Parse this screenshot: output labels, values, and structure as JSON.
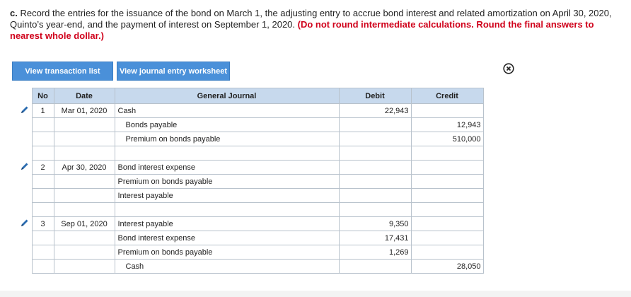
{
  "instructions": {
    "prefix": "c.",
    "text": " Record the entries for the issuance of the bond on March 1, the adjusting entry to accrue bond interest and related amortization on April 30, 2020, Quinto’s year-end, and the payment of interest on September 1, 2020.",
    "red": " (Do not round intermediate calculations. Round the final answers to nearest whole dollar.)"
  },
  "buttons": {
    "transaction_list": "View transaction list",
    "journal_worksheet": "View journal entry worksheet"
  },
  "close_icon": "circle-x-icon",
  "table": {
    "headers": [
      "No",
      "Date",
      "General Journal",
      "Debit",
      "Credit"
    ],
    "rows": [
      {
        "no": "1",
        "date": "Mar 01, 2020",
        "account": "Cash",
        "indent": false,
        "debit": "22,943",
        "credit": "",
        "edit": true
      },
      {
        "no": "",
        "date": "",
        "account": "Bonds payable",
        "indent": true,
        "debit": "",
        "credit": "12,943",
        "edit": false
      },
      {
        "no": "",
        "date": "",
        "account": "Premium on bonds payable",
        "indent": true,
        "debit": "",
        "credit": "510,000",
        "edit": false
      },
      {
        "no": "",
        "date": "",
        "account": "",
        "indent": false,
        "debit": "",
        "credit": "",
        "edit": false
      },
      {
        "no": "2",
        "date": "Apr 30, 2020",
        "account": "Bond interest expense",
        "indent": false,
        "debit": "",
        "credit": "",
        "edit": true
      },
      {
        "no": "",
        "date": "",
        "account": "Premium on bonds payable",
        "indent": false,
        "debit": "",
        "credit": "",
        "edit": false
      },
      {
        "no": "",
        "date": "",
        "account": "Interest payable",
        "indent": false,
        "debit": "",
        "credit": "",
        "edit": false
      },
      {
        "no": "",
        "date": "",
        "account": "",
        "indent": false,
        "debit": "",
        "credit": "",
        "edit": false
      },
      {
        "no": "3",
        "date": "Sep 01, 2020",
        "account": "Interest payable",
        "indent": false,
        "debit": "9,350",
        "credit": "",
        "edit": true
      },
      {
        "no": "",
        "date": "",
        "account": "Bond interest expense",
        "indent": false,
        "debit": "17,431",
        "credit": "",
        "edit": false
      },
      {
        "no": "",
        "date": "",
        "account": "Premium on bonds payable",
        "indent": false,
        "debit": "1,269",
        "credit": "",
        "edit": false
      },
      {
        "no": "",
        "date": "",
        "account": "Cash",
        "indent": true,
        "debit": "",
        "credit": "28,050",
        "edit": false
      }
    ]
  },
  "colors": {
    "button_blue": "#4a90d9",
    "header_blue": "#c7d9ed",
    "instruction_red": "#d0021b"
  }
}
